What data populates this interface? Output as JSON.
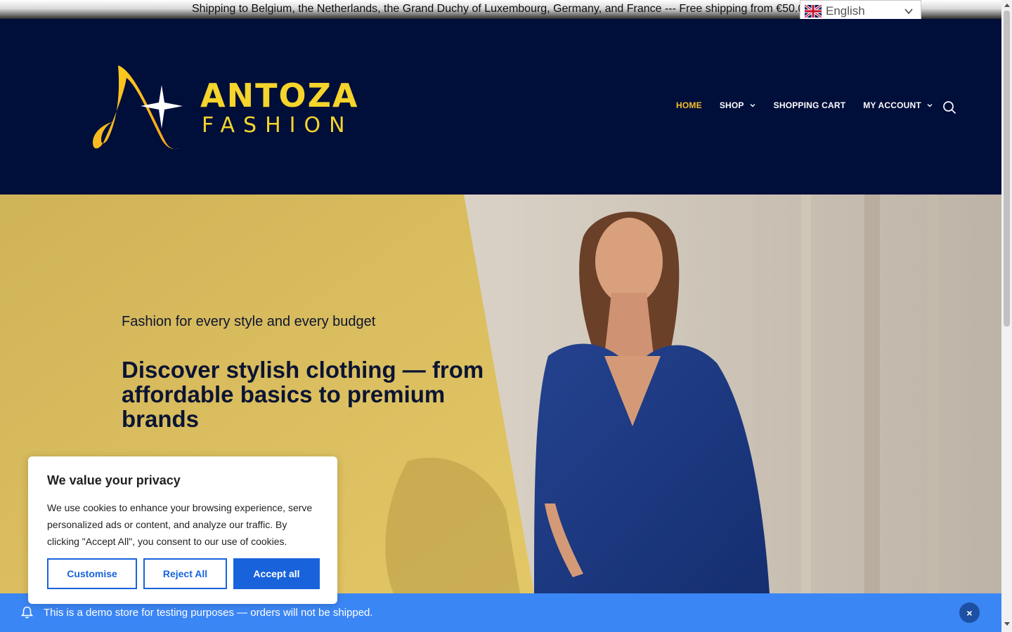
{
  "topbar": {
    "announcement": "Shipping to Belgium, the Netherlands, the Grand Duchy of Luxembourg, Germany, and France --- Free shipping from €50.00",
    "language": "English",
    "flag_icon": "uk-flag-icon"
  },
  "brand": {
    "name_line1": "ANTOZA",
    "name_line2": "FASHION",
    "accent_color": "#f5d42b",
    "header_bg": "#000e3a"
  },
  "nav": {
    "items": [
      {
        "label": "HOME",
        "active": true
      },
      {
        "label": "SHOP",
        "has_dropdown": true
      },
      {
        "label": "SHOPPING CART"
      },
      {
        "label": "MY ACCOUNT",
        "has_dropdown": true
      }
    ],
    "search_icon": "search-icon"
  },
  "hero": {
    "subtitle": "Fashion for every style and every budget",
    "title": "Discover stylish clothing — from affordable basics to premium brands"
  },
  "cookie": {
    "title": "We value your privacy",
    "body": "We use cookies to enhance your browsing experience, serve personalized ads or content, and analyze our traffic. By clicking \"Accept All\", you consent to our use of cookies.",
    "customise": "Customise",
    "reject": "Reject All",
    "accept": "Accept all",
    "button_color": "#1863dc"
  },
  "demo_notice": {
    "text": "This is a demo store for testing purposes — orders will not be shipped.",
    "close": "×",
    "bg_color": "#3b86f5"
  }
}
